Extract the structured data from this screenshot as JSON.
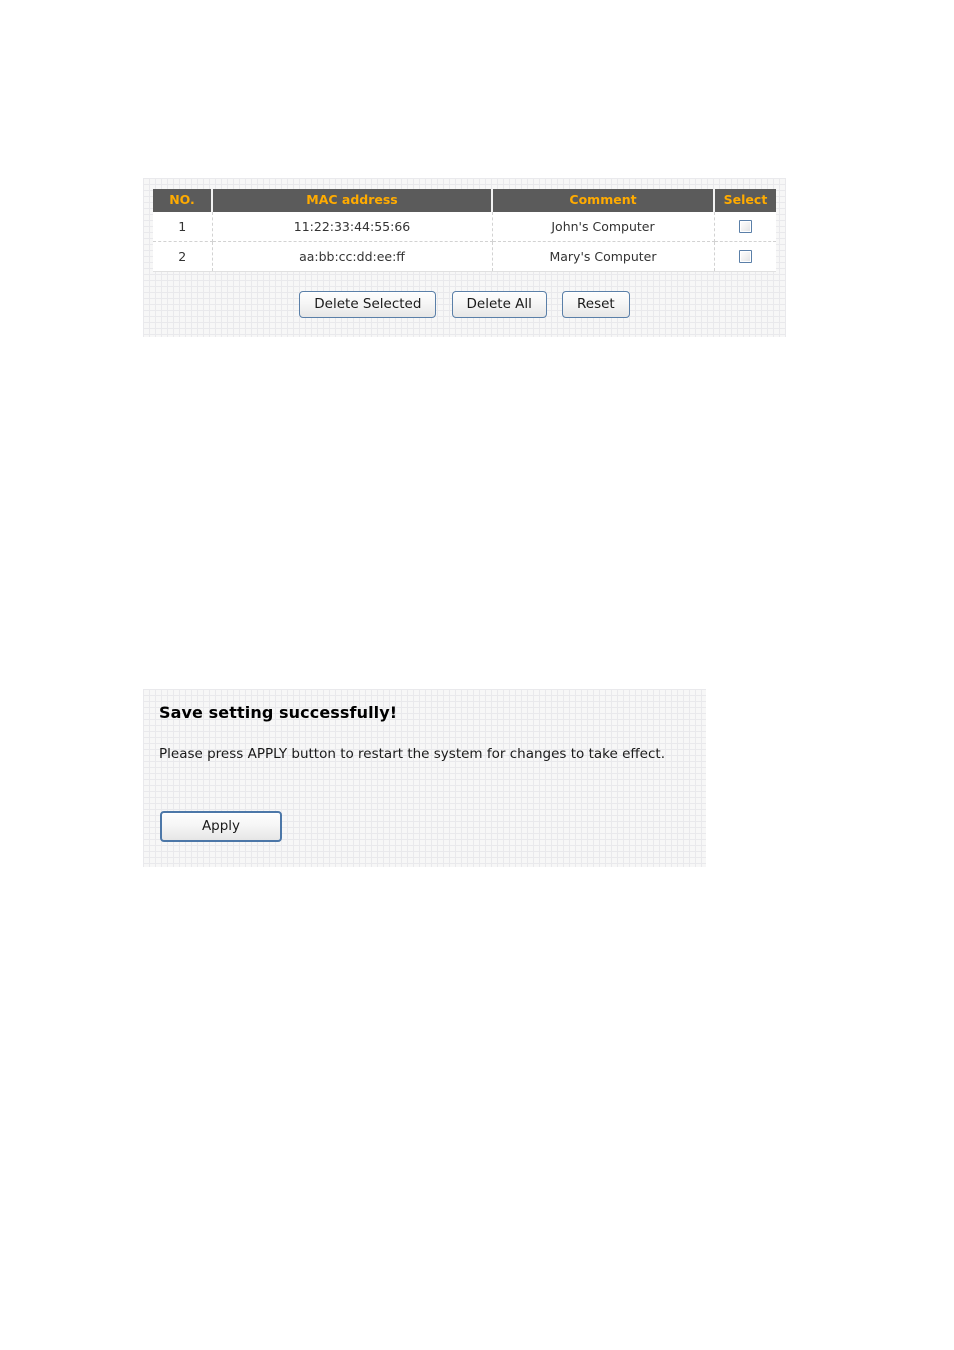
{
  "mac_panel": {
    "table": {
      "columns": [
        "NO.",
        "MAC address",
        "Comment",
        "Select"
      ],
      "rows": [
        {
          "no": "1",
          "mac": "11:22:33:44:55:66",
          "comment": "John's Computer",
          "selected": false
        },
        {
          "no": "2",
          "mac": "aa:bb:cc:dd:ee:ff",
          "comment": "Mary's Computer",
          "selected": false
        }
      ]
    },
    "buttons": {
      "delete_selected": "Delete Selected",
      "delete_all": "Delete All",
      "reset": "Reset"
    }
  },
  "save_panel": {
    "heading": "Save setting successfully!",
    "message": "Please press APPLY button to restart the system for changes to take effect.",
    "apply_label": "Apply"
  },
  "colors": {
    "header_bg": "#5b5b5b",
    "header_text": "#ffab00",
    "panel_bg": "#f7f7f7",
    "grid_line": "#e9e9ec",
    "button_border": "#5a7fa8",
    "checkbox_border": "#5a7fa8",
    "body_text": "#333333"
  }
}
